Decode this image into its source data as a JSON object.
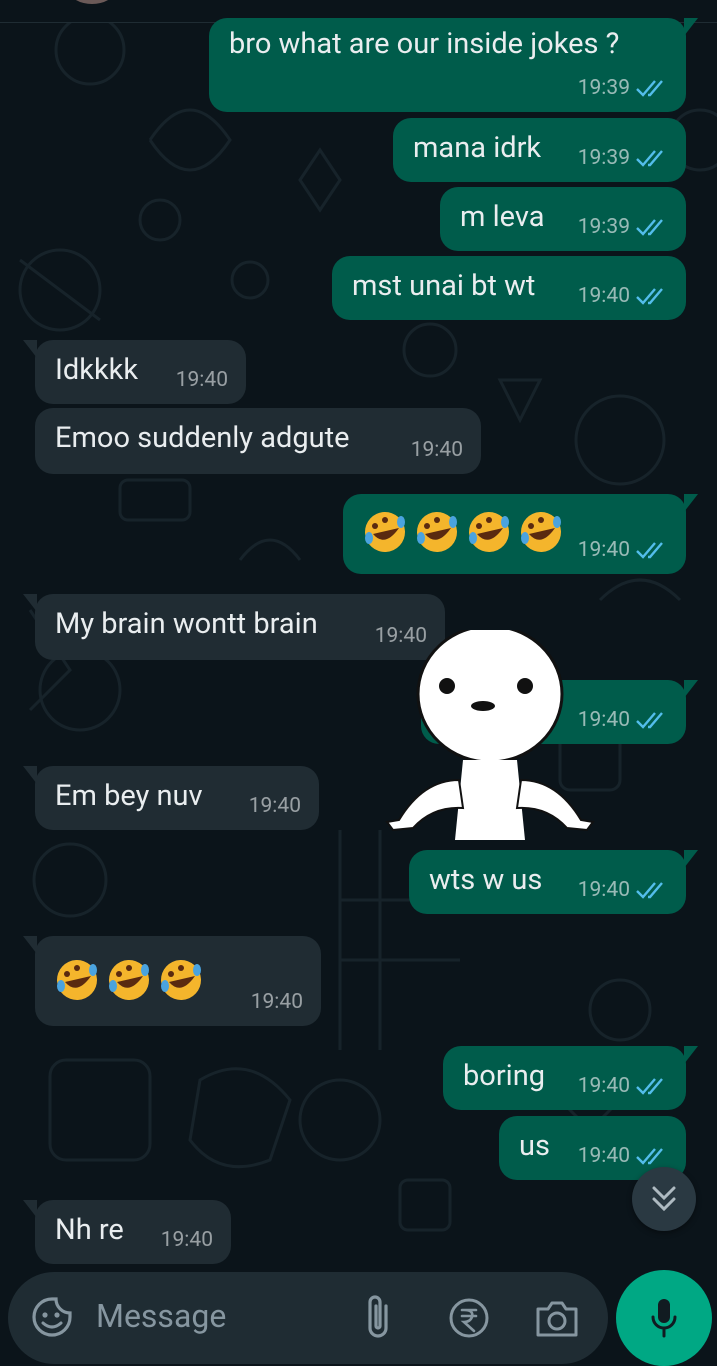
{
  "composer": {
    "placeholder": "Message"
  },
  "messages": [
    {
      "dir": "out",
      "text": "bro what are our inside jokes ?",
      "time": "19:39"
    },
    {
      "dir": "out",
      "text": "mana idrk",
      "time": "19:39"
    },
    {
      "dir": "out",
      "text": "m leva",
      "time": "19:39"
    },
    {
      "dir": "out",
      "text": "mst unai bt wt",
      "time": "19:40"
    },
    {
      "dir": "in",
      "text": "Idkkkk",
      "time": "19:40"
    },
    {
      "dir": "in",
      "text": "Emoo suddenly adgute",
      "time": "19:40"
    },
    {
      "dir": "out",
      "text": "🤣🤣🤣🤣",
      "time": "19:40"
    },
    {
      "dir": "in",
      "text": "My brain wontt brain",
      "time": "19:40"
    },
    {
      "dir": "out",
      "text": "[sticker]",
      "time": "19:40"
    },
    {
      "dir": "in",
      "text": "Em bey nuv",
      "time": "19:40"
    },
    {
      "dir": "out",
      "text": "wts w us",
      "time": "19:40"
    },
    {
      "dir": "in",
      "text": "🤣🤣🤣",
      "time": "19:40"
    },
    {
      "dir": "out",
      "text": "boring",
      "time": "19:40"
    },
    {
      "dir": "out",
      "text": "us",
      "time": "19:40"
    },
    {
      "dir": "in",
      "text": "Nh re",
      "time": "19:40"
    }
  ],
  "icons": {
    "read_receipt": "double-check-icon",
    "scroll_down": "chevron-double-down-icon",
    "emoji_button": "sticker-smile-icon",
    "attach": "paperclip-icon",
    "payment": "rupee-icon",
    "camera": "camera-icon",
    "mic": "microphone-icon"
  },
  "colors": {
    "background": "#0b141a",
    "outgoing_bubble": "#005c4b",
    "incoming_bubble": "#202c33",
    "read_tick": "#53bdeb",
    "accent": "#00a884"
  }
}
